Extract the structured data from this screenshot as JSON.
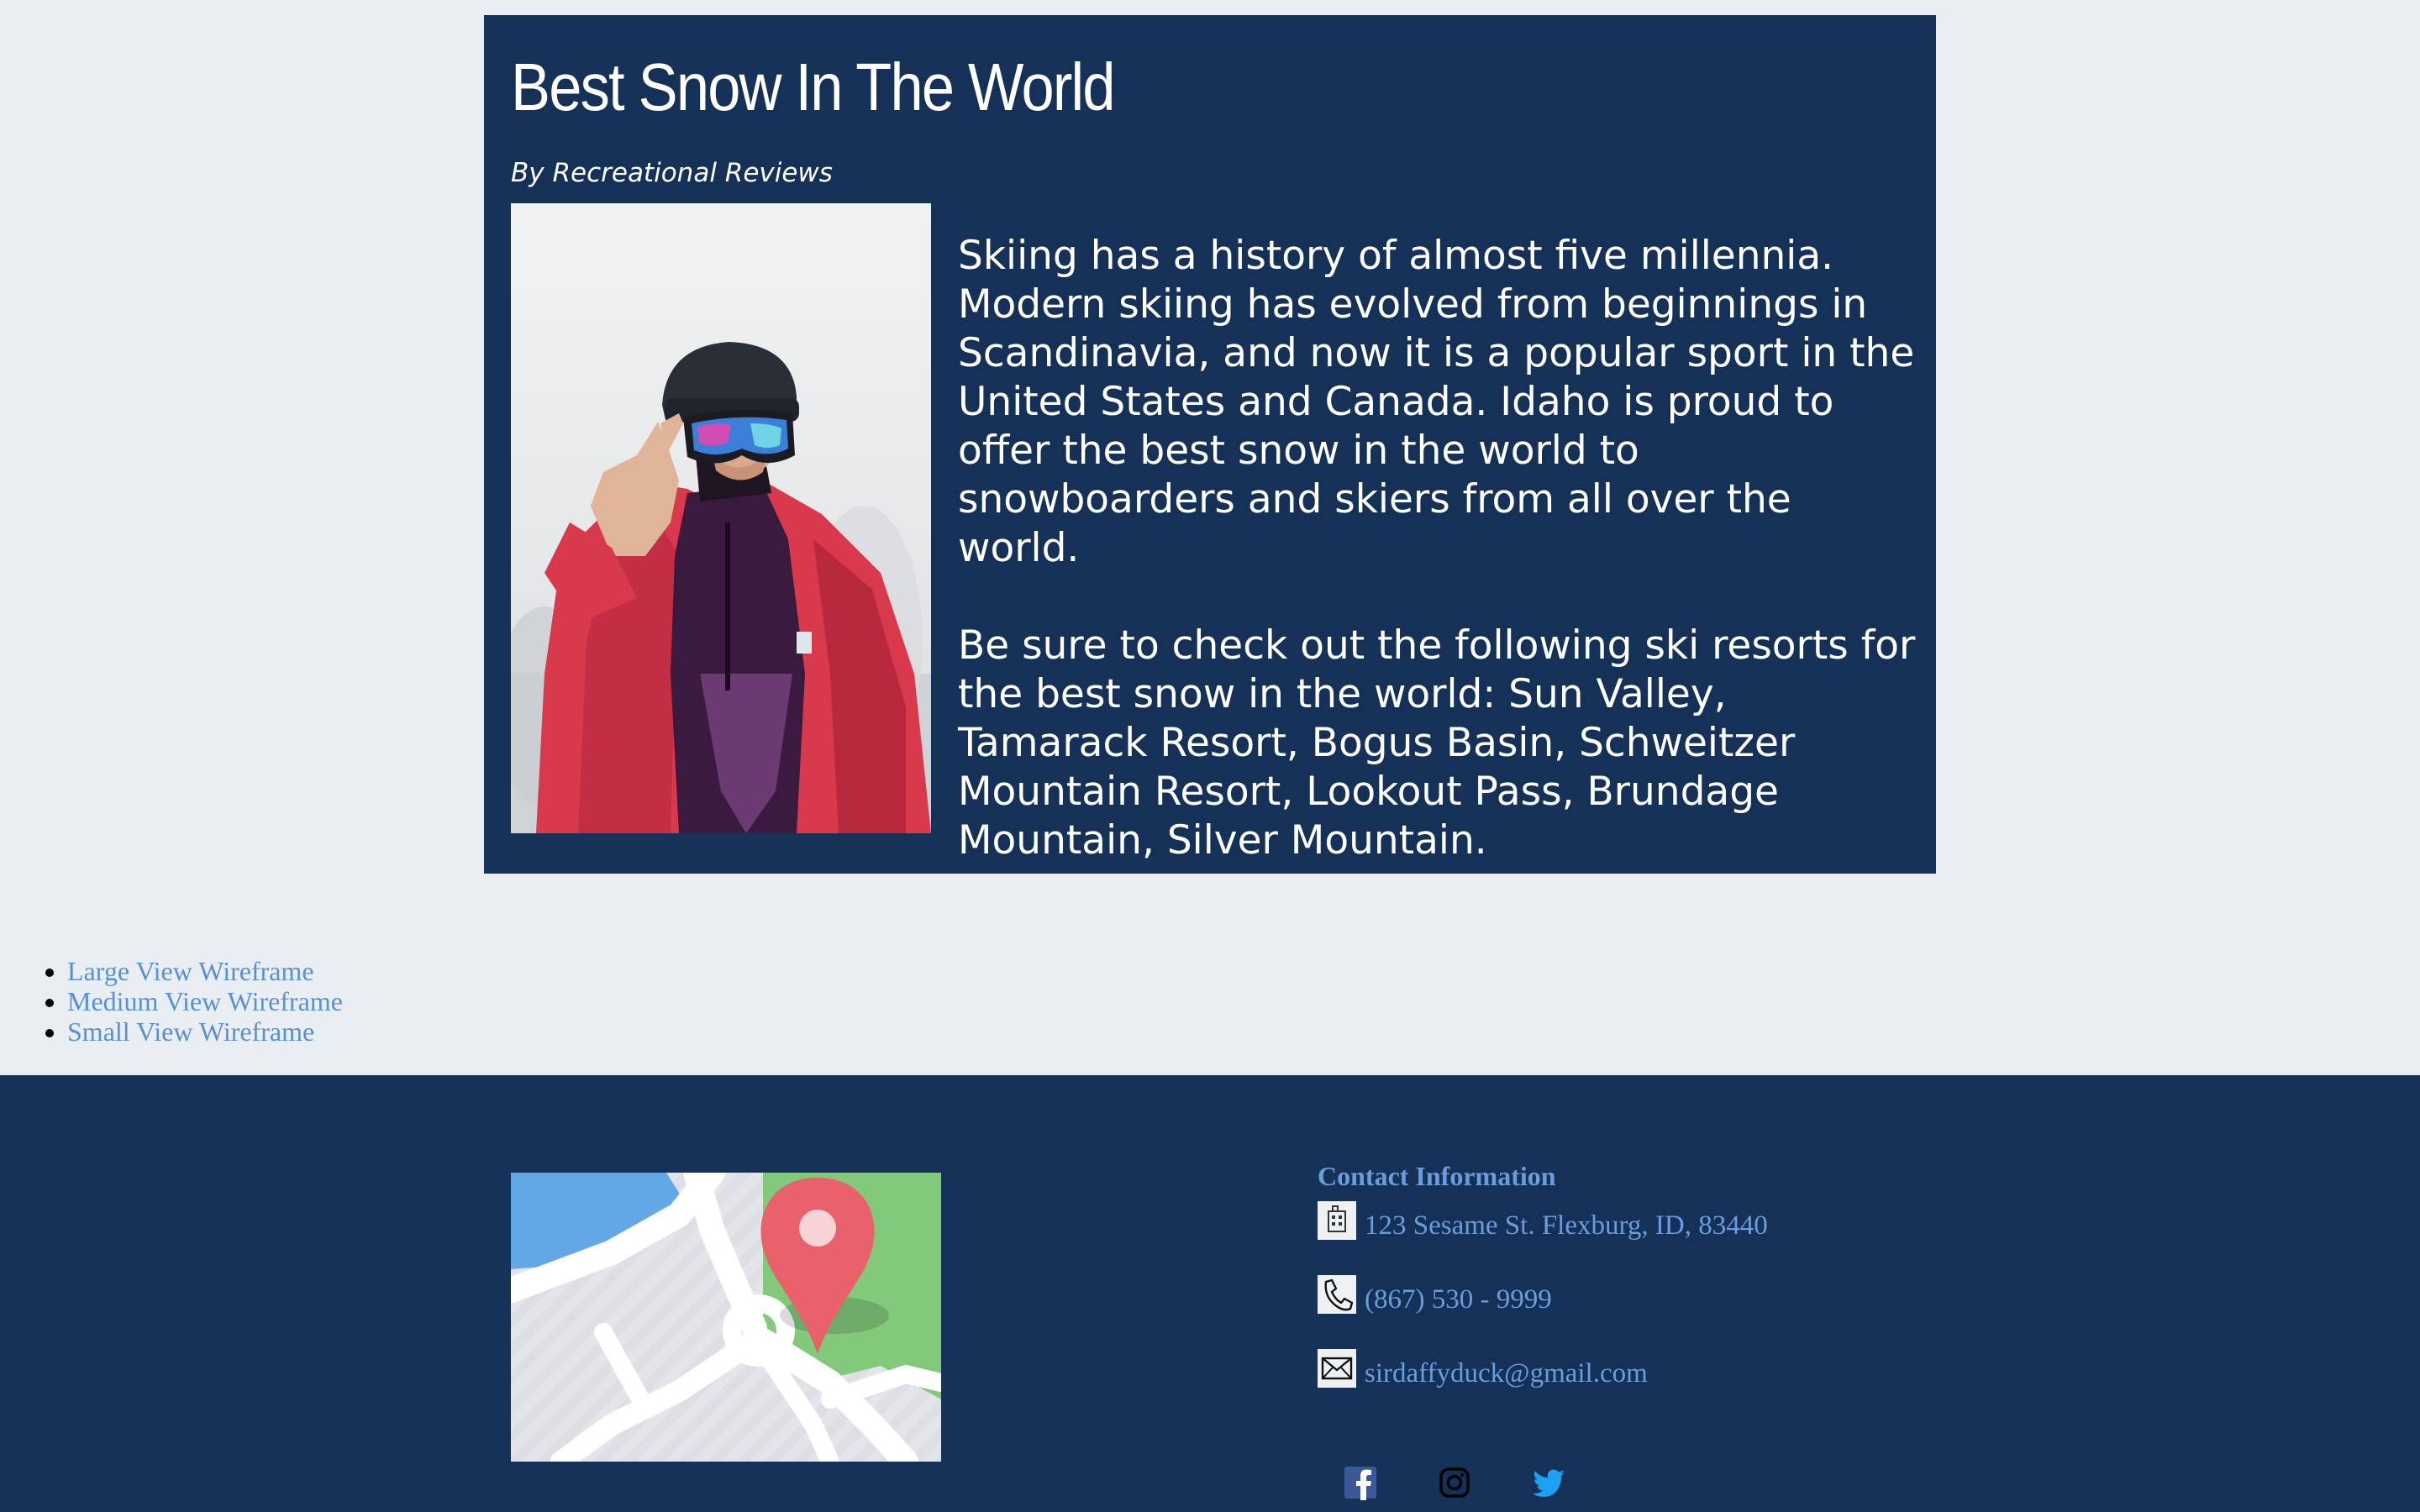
{
  "article": {
    "title": "Best Snow In The World",
    "byline": "By Recreational Reviews",
    "paragraphs": [
      "Skiing has a history of almost five millennia. Modern skiing has evolved from beginnings in Scandinavia, and now it is a popular sport in the United States and Canada. Idaho is proud to offer the best snow in the world to snowboarders and skiers from all over the world.",
      "Be sure to check out the following ski resorts for the best snow in the world: Sun Valley, Tamarack Resort, Bogus Basin, Schweitzer Mountain Resort, Lookout Pass, Brundage Mountain, Silver Mountain."
    ],
    "photo_icon": "snowboarder-photo"
  },
  "wireframe_links": [
    "Large View Wireframe",
    "Medium View Wireframe",
    "Small View Wireframe"
  ],
  "footer": {
    "map_icon": "map-pin-icon",
    "contact": {
      "heading": "Contact Information",
      "address": "123 Sesame St. Flexburg, ID, 83440",
      "phone": "(867) 530 - 9999",
      "email": "sirdaffyduck@gmail.com"
    },
    "social_icons": [
      "facebook-icon",
      "instagram-icon",
      "twitter-icon"
    ]
  },
  "colors": {
    "page_background": "#e9eef2",
    "navy": "#163158",
    "link_blue": "#5a8fd0",
    "contact_blue": "#6b9cdc"
  }
}
